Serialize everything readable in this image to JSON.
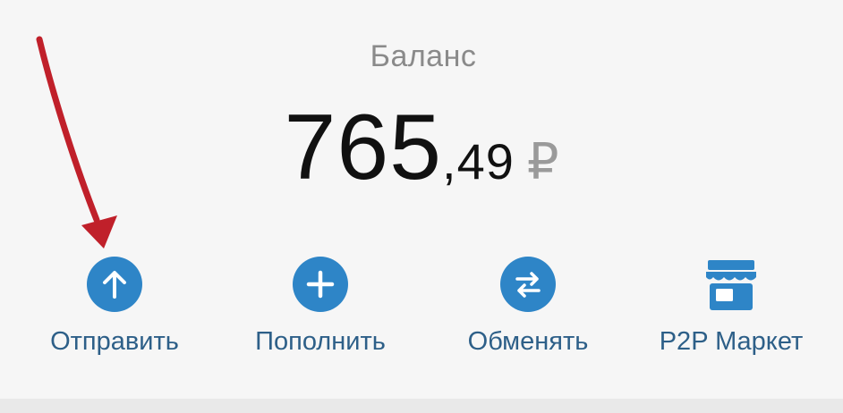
{
  "balance": {
    "label": "Баланс",
    "amount_whole": "765",
    "amount_fraction": ",49",
    "currency": "₽"
  },
  "actions": [
    {
      "label": "Отправить",
      "icon": "arrow-up-icon"
    },
    {
      "label": "Пополнить",
      "icon": "plus-icon"
    },
    {
      "label": "Обменять",
      "icon": "swap-arrows-icon"
    },
    {
      "label": "P2P Маркет",
      "icon": "store-icon"
    }
  ],
  "colors": {
    "accent": "#2e85c7",
    "label": "#2d5f88",
    "annotation_arrow": "#c0202a"
  }
}
